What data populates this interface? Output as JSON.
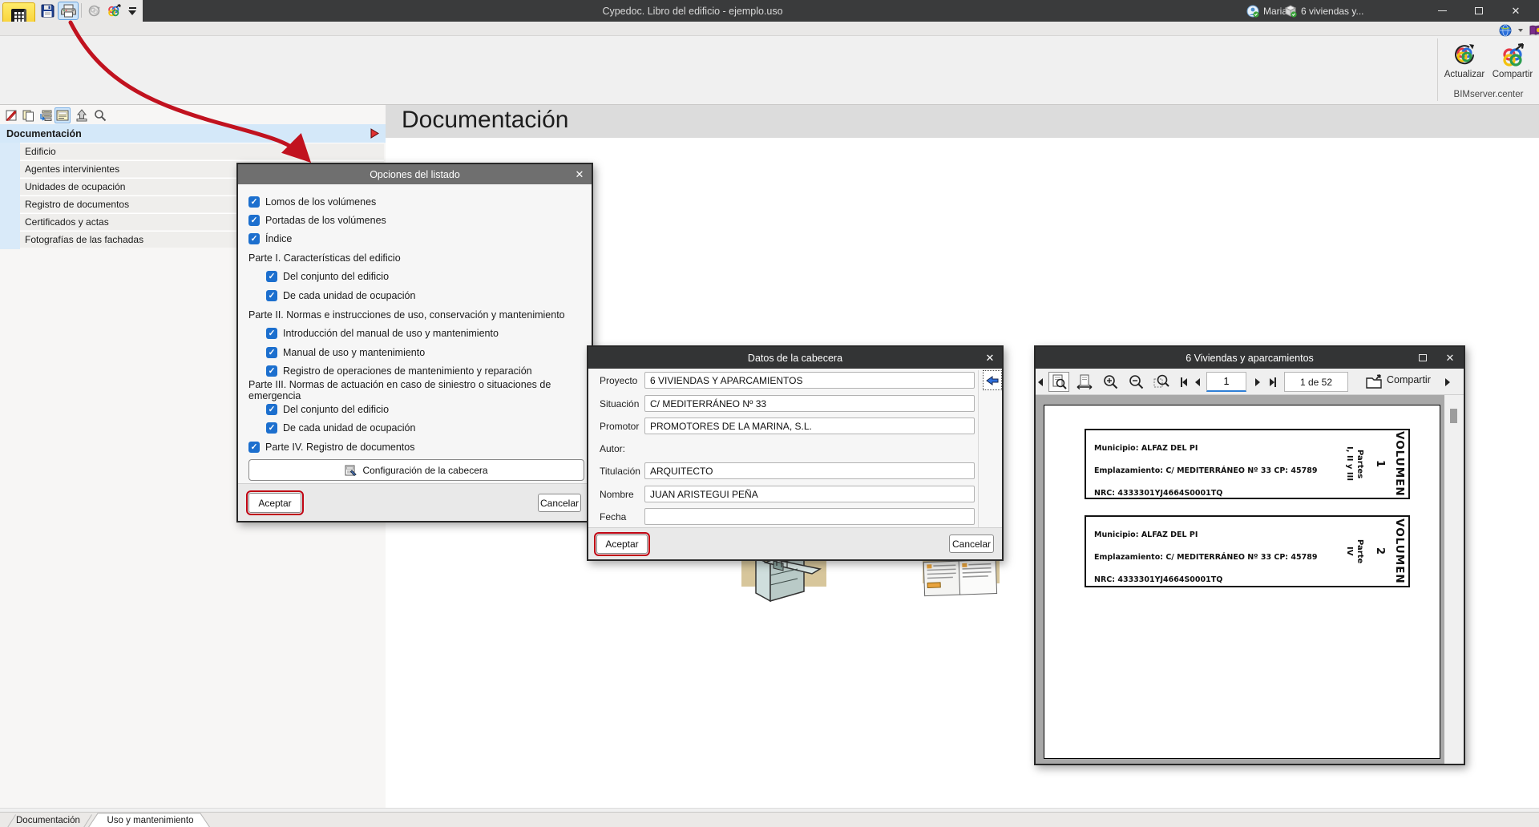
{
  "icons": {
    "close": "✕",
    "search": "🔍"
  },
  "window": {
    "title": "Cypedoc. Libro del edificio - ejemplo.uso",
    "user": "Maria",
    "project": "6 viviendas y..."
  },
  "ribbon": {
    "actualizar": "Actualizar",
    "compartir": "Compartir",
    "group_label": "BIMserver.center"
  },
  "sidebar": {
    "root": "Documentación",
    "items": [
      "Edificio",
      "Agentes intervinientes",
      "Unidades de ocupación",
      "Registro de documentos",
      "Certificados y actas",
      "Fotografías de las fachadas"
    ]
  },
  "main": {
    "heading": "Documentación"
  },
  "tabs": {
    "items": [
      "Documentación",
      "Uso y mantenimiento"
    ]
  },
  "opciones_dialog": {
    "title": "Opciones del listado",
    "rows": [
      {
        "label": "Lomos de los volúmenes"
      },
      {
        "label": "Portadas de los volúmenes"
      },
      {
        "label": "Índice"
      },
      {
        "label": "Parte I. Características del edificio"
      },
      {
        "label": "Del conjunto del edificio"
      },
      {
        "label": "De cada unidad de ocupación"
      },
      {
        "label": "Parte II. Normas e instrucciones de uso, conservación y mantenimiento"
      },
      {
        "label": "Introducción del manual de uso y mantenimiento"
      },
      {
        "label": "Manual de uso y mantenimiento"
      },
      {
        "label": "Registro de operaciones de mantenimiento y reparación"
      },
      {
        "label": "Parte III. Normas de actuación en caso de siniestro o situaciones de emergencia"
      },
      {
        "label": "Del conjunto del edificio"
      },
      {
        "label": "De cada unidad de ocupación"
      },
      {
        "label": "Parte IV. Registro de documentos"
      }
    ],
    "config_button": "Configuración de la cabecera",
    "aceptar": "Aceptar",
    "cancelar": "Cancelar"
  },
  "datos_dialog": {
    "title": "Datos de la cabecera",
    "fields": [
      {
        "label": "Proyecto",
        "value": "6 VIVIENDAS Y APARCAMIENTOS"
      },
      {
        "label": "Situación",
        "value": "C/ MEDITERRÁNEO Nº 33"
      },
      {
        "label": "Promotor",
        "value": "PROMOTORES DE LA MARINA, S.L."
      },
      {
        "label": "Autor:",
        "value": ""
      },
      {
        "label": "Titulación",
        "value": "ARQUITECTO"
      },
      {
        "label": "Nombre",
        "value": "JUAN ARISTEGUI PEÑA"
      },
      {
        "label": "Fecha",
        "value": ""
      }
    ],
    "aceptar": "Aceptar",
    "cancelar": "Cancelar"
  },
  "preview_window": {
    "title": "6 Viviendas y aparcamientos",
    "page_value": "1",
    "page_count": "1 de 52",
    "compartir": "Compartir",
    "volumes": [
      {
        "l1": "Municipio: ALFAZ DEL PI",
        "l2": "Emplazamiento: C/ MEDITERRÁNEO Nº 33 CP: 45789",
        "l3": "NRC: 4333301YJ4664S0001TQ",
        "volumen": "VOLUMEN",
        "numero": "1",
        "parte_label": "Partes",
        "parte_detail": "I, II y III"
      },
      {
        "l1": "Municipio: ALFAZ DEL PI",
        "l2": "Emplazamiento: C/ MEDITERRÁNEO Nº 33 CP: 45789",
        "l3": "NRC: 4333301YJ4664S0001TQ",
        "volumen": "VOLUMEN",
        "numero": "2",
        "parte_label": "Parte",
        "parte_detail": "IV"
      }
    ]
  }
}
